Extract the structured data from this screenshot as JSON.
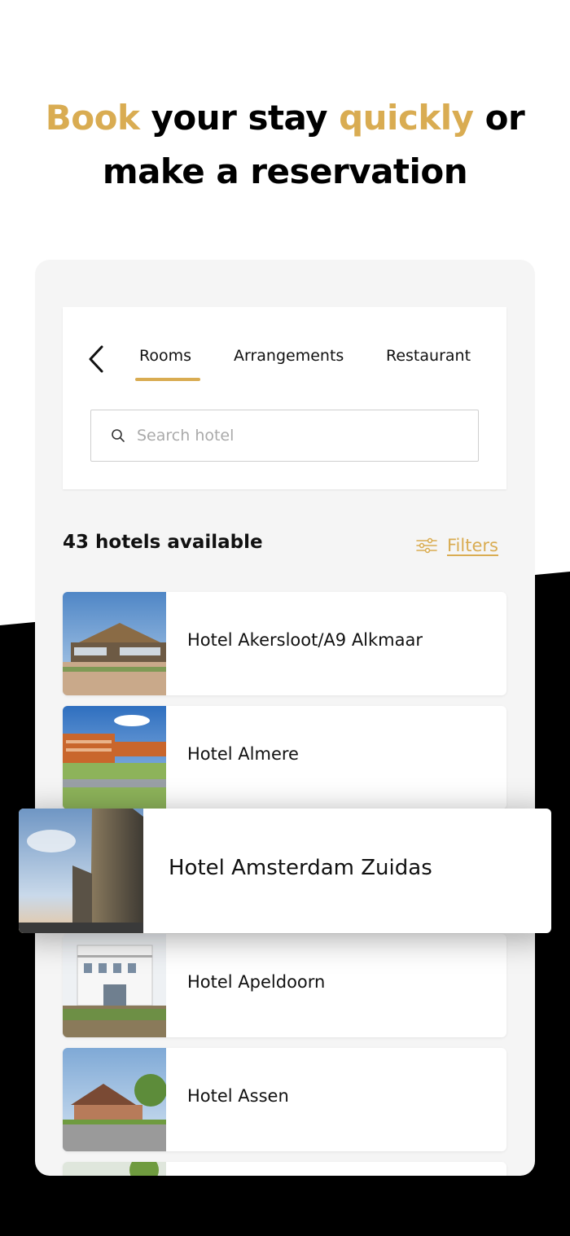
{
  "headline": {
    "part1": "Book",
    "part2": " your stay ",
    "part3": "quickly",
    "part4": " or",
    "line2": "make a reservation"
  },
  "colors": {
    "accent": "#d9ac52",
    "text": "#111111",
    "panel": "#f5f5f5"
  },
  "nav": {
    "back_icon": "chevron-left-icon",
    "tabs": [
      {
        "label": "Rooms",
        "active": true
      },
      {
        "label": "Arrangements",
        "active": false
      },
      {
        "label": "Restaurant",
        "active": false
      }
    ]
  },
  "search": {
    "placeholder": "Search hotel",
    "value": "",
    "icon": "search-icon"
  },
  "results": {
    "count_label": "43 hotels available",
    "filters_label": "Filters",
    "filters_icon": "sliders-icon"
  },
  "hotels": [
    {
      "name": "Hotel Akersloot/A9 Alkmaar"
    },
    {
      "name": "Hotel Almere"
    },
    {
      "name": "Hotel Amsterdam Zuidas",
      "highlighted": true
    },
    {
      "name": "Hotel Apeldoorn"
    },
    {
      "name": "Hotel Assen"
    }
  ]
}
